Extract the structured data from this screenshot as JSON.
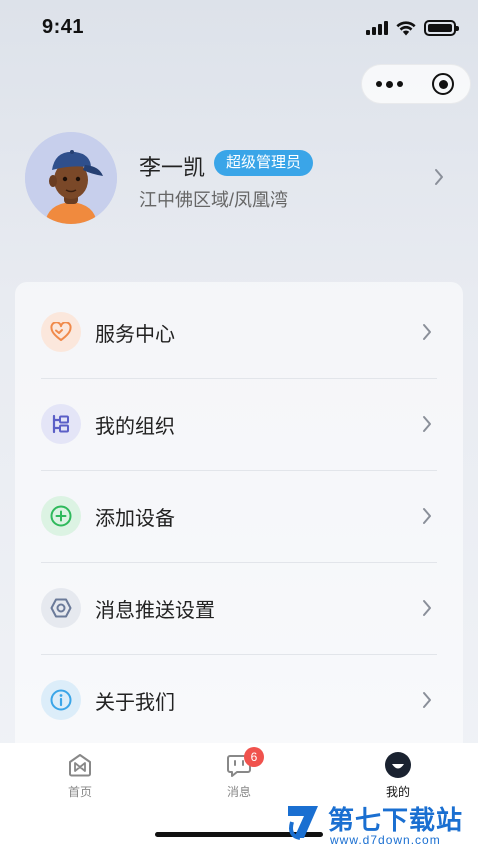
{
  "status_bar": {
    "time": "9:41",
    "icons": [
      "signal-icon",
      "wifi-icon",
      "battery-icon"
    ]
  },
  "capsule": {
    "icons": [
      "more-icon",
      "target-icon"
    ]
  },
  "profile": {
    "name": "李一凯",
    "role_badge": "超级管理员",
    "location": "江中佛区域/凤凰湾",
    "avatar_icon": "avatar-3d-boy-cap",
    "chevron": "chevron-right-icon"
  },
  "menu": {
    "items": [
      {
        "label": "服务中心",
        "icon": "heart-icon",
        "icon_color": "#f08a4b",
        "icon_bg": "#fbe7dc"
      },
      {
        "label": "我的组织",
        "icon": "org-icon",
        "icon_color": "#5b5fc7",
        "icon_bg": "#e4e5f7"
      },
      {
        "label": "添加设备",
        "icon": "plus-circle-icon",
        "icon_color": "#2fb95c",
        "icon_bg": "#dcf3e3"
      },
      {
        "label": "消息推送设置",
        "icon": "hexagon-settings-icon",
        "icon_color": "#6b7a99",
        "icon_bg": "#e6e9ef"
      },
      {
        "label": "关于我们",
        "icon": "info-icon",
        "icon_color": "#3aa5e8",
        "icon_bg": "#dcedf9"
      }
    ]
  },
  "tab_bar": {
    "tabs": [
      {
        "label": "首页",
        "icon": "home-icon",
        "active": false
      },
      {
        "label": "消息",
        "icon": "message-icon",
        "active": false,
        "badge": "6"
      },
      {
        "label": "我的",
        "icon": "profile-icon",
        "active": true
      }
    ]
  },
  "watermark": {
    "title": "第七下载站",
    "url": "www.d7down.com"
  },
  "colors": {
    "accent_blue": "#3aa5e8",
    "badge_red": "#f0524d"
  }
}
